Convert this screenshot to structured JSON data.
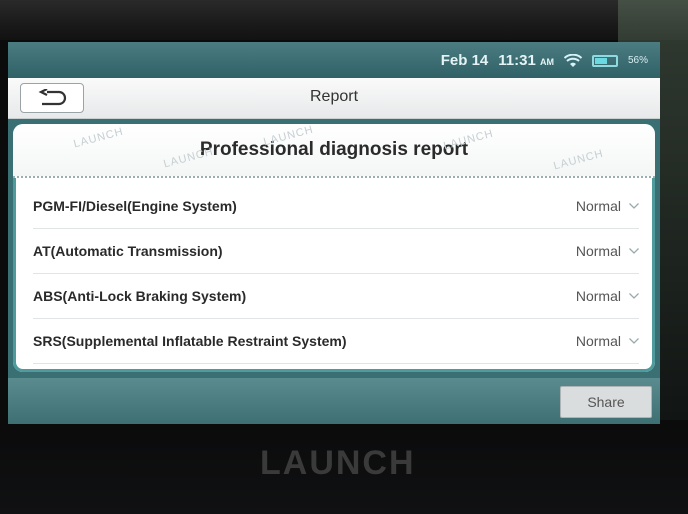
{
  "status_bar": {
    "date": "Feb 14",
    "time": "11:31",
    "time_suffix": "AM",
    "battery_percent": "56%",
    "battery_level": 0.56
  },
  "titlebar": {
    "back_icon": "back-arrow-icon",
    "title": "Report"
  },
  "report": {
    "header": "Professional diagnosis report",
    "watermark": "LAUNCH",
    "rows": [
      {
        "label": "PGM-FI/Diesel(Engine System)",
        "status": "Normal"
      },
      {
        "label": "AT(Automatic Transmission)",
        "status": "Normal"
      },
      {
        "label": "ABS(Anti-Lock Braking System)",
        "status": "Normal"
      },
      {
        "label": "SRS(Supplemental Inflatable Restraint System)",
        "status": "Normal"
      }
    ]
  },
  "actions": {
    "share_label": "Share"
  },
  "device": {
    "brand": "LAUNCH"
  },
  "colors": {
    "accent": "#3a6f73",
    "panel": "#ffffff",
    "text": "#2a2a2a"
  }
}
